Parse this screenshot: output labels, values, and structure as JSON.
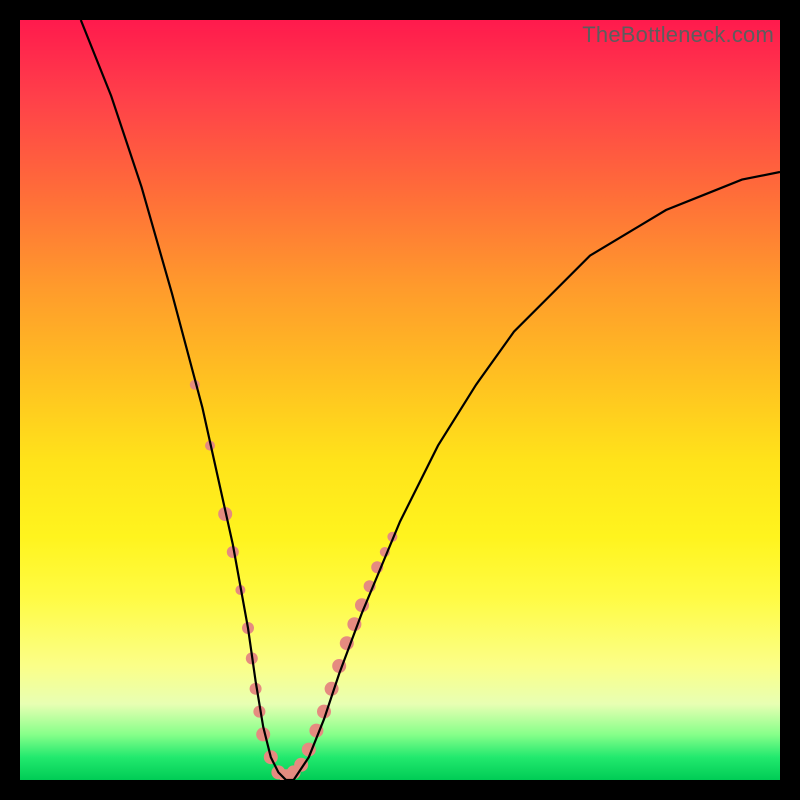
{
  "watermark": "TheBottleneck.com",
  "chart_data": {
    "type": "line",
    "title": "",
    "xlabel": "",
    "ylabel": "",
    "xlim": [
      0,
      100
    ],
    "ylim": [
      0,
      100
    ],
    "background_gradient": {
      "top": "#ff1a4d",
      "mid": "#ffe31a",
      "bottom": "#00cc55"
    },
    "series": [
      {
        "name": "curve",
        "x": [
          8,
          12,
          16,
          20,
          24,
          26,
          28,
          30,
          31,
          32,
          33,
          34,
          35,
          36,
          38,
          40,
          42,
          45,
          50,
          55,
          60,
          65,
          70,
          75,
          80,
          85,
          90,
          95,
          100
        ],
        "y": [
          100,
          90,
          78,
          64,
          49,
          40,
          31,
          20,
          13,
          7,
          3,
          1,
          0,
          0,
          3,
          8,
          14,
          22,
          34,
          44,
          52,
          59,
          64,
          69,
          72,
          75,
          77,
          79,
          80
        ]
      }
    ],
    "markers": [
      {
        "x": 23.0,
        "y": 52.0,
        "r": 5
      },
      {
        "x": 25.0,
        "y": 44.0,
        "r": 5
      },
      {
        "x": 27.0,
        "y": 35.0,
        "r": 7
      },
      {
        "x": 28.0,
        "y": 30.0,
        "r": 6
      },
      {
        "x": 29.0,
        "y": 25.0,
        "r": 5
      },
      {
        "x": 30.0,
        "y": 20.0,
        "r": 6
      },
      {
        "x": 30.5,
        "y": 16.0,
        "r": 6
      },
      {
        "x": 31.0,
        "y": 12.0,
        "r": 6
      },
      {
        "x": 31.5,
        "y": 9.0,
        "r": 6
      },
      {
        "x": 32.0,
        "y": 6.0,
        "r": 7
      },
      {
        "x": 33.0,
        "y": 3.0,
        "r": 7
      },
      {
        "x": 34.0,
        "y": 1.0,
        "r": 7
      },
      {
        "x": 35.0,
        "y": 0.5,
        "r": 7
      },
      {
        "x": 36.0,
        "y": 1.0,
        "r": 7
      },
      {
        "x": 37.0,
        "y": 2.0,
        "r": 7
      },
      {
        "x": 38.0,
        "y": 4.0,
        "r": 7
      },
      {
        "x": 39.0,
        "y": 6.5,
        "r": 7
      },
      {
        "x": 40.0,
        "y": 9.0,
        "r": 7
      },
      {
        "x": 41.0,
        "y": 12.0,
        "r": 7
      },
      {
        "x": 42.0,
        "y": 15.0,
        "r": 7
      },
      {
        "x": 43.0,
        "y": 18.0,
        "r": 7
      },
      {
        "x": 44.0,
        "y": 20.5,
        "r": 7
      },
      {
        "x": 45.0,
        "y": 23.0,
        "r": 7
      },
      {
        "x": 46.0,
        "y": 25.5,
        "r": 6
      },
      {
        "x": 47.0,
        "y": 28.0,
        "r": 6
      },
      {
        "x": 48.0,
        "y": 30.0,
        "r": 5
      },
      {
        "x": 49.0,
        "y": 32.0,
        "r": 5
      }
    ],
    "marker_color": "#e58b80"
  }
}
